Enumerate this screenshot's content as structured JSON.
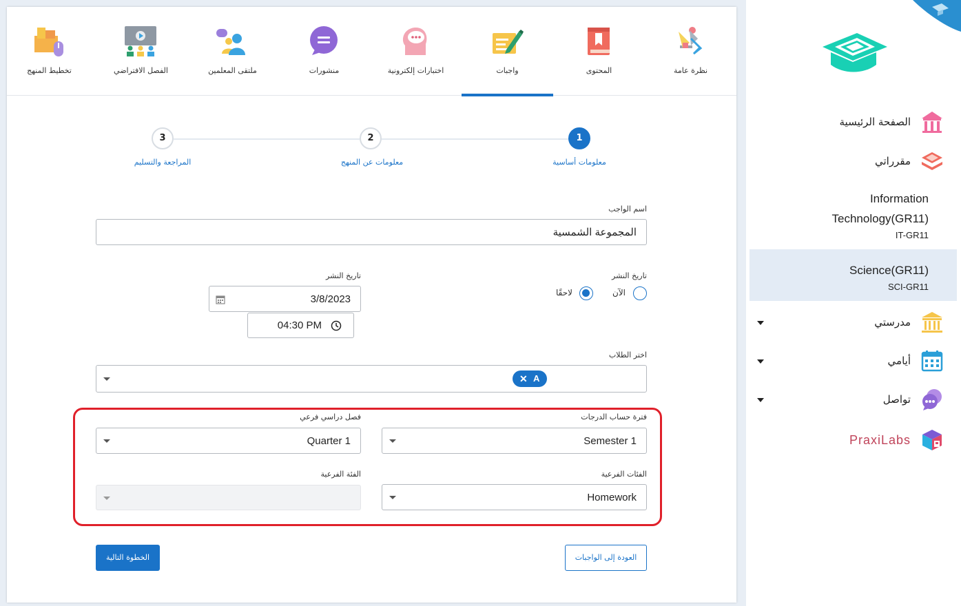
{
  "tabs": [
    {
      "label": "نظرة عامة",
      "icon": "overview-icon"
    },
    {
      "label": "المحتوى",
      "icon": "book-icon"
    },
    {
      "label": "واجبات",
      "icon": "assignment-icon",
      "active": true
    },
    {
      "label": "اختبارات إلكترونية",
      "icon": "quiz-icon"
    },
    {
      "label": "منشورات",
      "icon": "posts-icon"
    },
    {
      "label": "ملتقى المعلمين",
      "icon": "teachers-forum-icon"
    },
    {
      "label": "الفصل الافتراضي",
      "icon": "virtual-class-icon"
    },
    {
      "label": "تخطيط المنهج",
      "icon": "curriculum-planning-icon"
    }
  ],
  "stepper": {
    "steps": [
      {
        "number": "1",
        "label": "معلومات أساسية",
        "active": true
      },
      {
        "number": "2",
        "label": "معلومات عن المنهج"
      },
      {
        "number": "3",
        "label": "المراجعة والتسليم"
      }
    ]
  },
  "form": {
    "assignment_name_label": "اسم الواجب",
    "assignment_name_value": "المجموعة الشمسية",
    "publish_label": "تاريخ النشر",
    "publish_now": "الآن",
    "publish_later": "لاحقًا",
    "publish_date_label": "تاريخ النشر",
    "publish_date_value": "3/8/2023",
    "publish_time_value": "04:30 PM",
    "students_label": "اختر الطلاب",
    "students_chip": "A",
    "grading_period_label": "فترة حساب الدرجات",
    "grading_period_value": "Semester 1",
    "sub_term_label": "فصل دراسي فرعي",
    "sub_term_value": "Quarter 1",
    "subcategories_label": "الفئات الفرعية",
    "subcategories_value": "Homework",
    "subcategory_label": "الفئة الفرعية",
    "subcategory_value": ""
  },
  "buttons": {
    "next_step": "الخطوة التالية",
    "back_to_assignments": "العودة إلى الواجبات"
  },
  "sidebar": {
    "home": "الصفحة الرئيسية",
    "my_courses": "مقرراتي",
    "courses": [
      {
        "name_line1": "Information",
        "name_line2": "Technology(GR11)",
        "code": "IT-GR11"
      },
      {
        "name_line1": "Science(GR11)",
        "code": "SCI-GR11",
        "active": true
      }
    ],
    "my_school": "مدرستي",
    "my_days": "أيامي",
    "communication": "تواصل",
    "praxilabs": "PraxiLabs"
  },
  "colors": {
    "accent": "#1a73c8",
    "highlight_border": "#e0202a",
    "active_course_bg": "#e3ebf5",
    "logo": "#19d0b4",
    "praxilabs_text": "#c0445a"
  }
}
